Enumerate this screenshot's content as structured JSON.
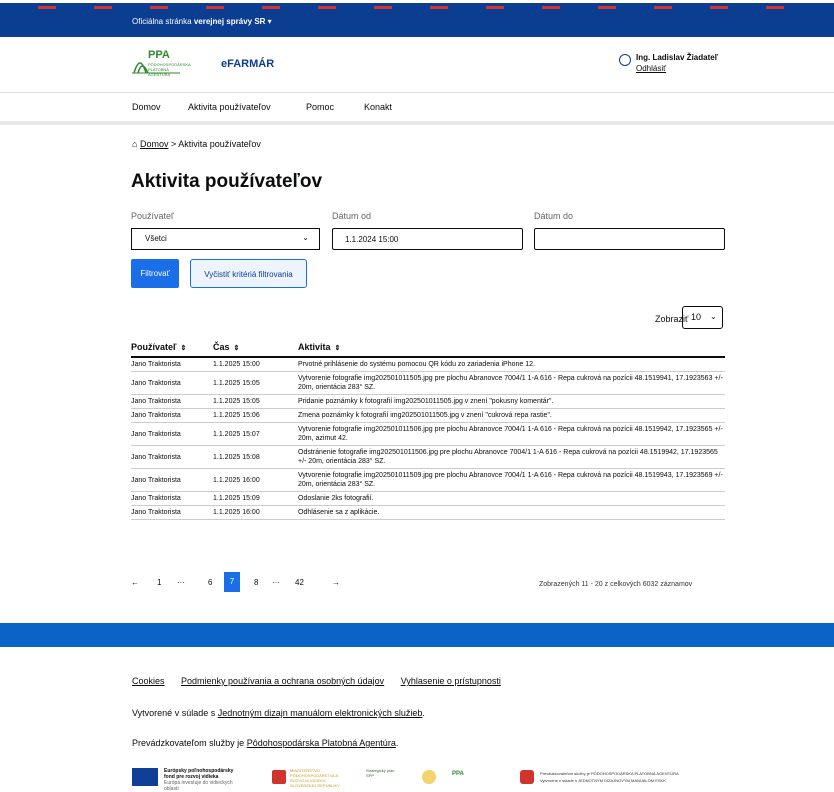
{
  "topbar": {
    "prefix": "Oficiálna stránka",
    "bold": "verejnej správy SR",
    "caret": "▾"
  },
  "header": {
    "logo_text": "PPA",
    "logo_sub": "PÔDOHOSPODÁRSKA PLATOBNÁ AGENTÚRA",
    "app_name": "eFARMÁR",
    "user_name": "Ing. Ladislav Žiadateľ",
    "logout": "Odhlásiť"
  },
  "nav": {
    "items": [
      "Domov",
      "Aktivita používateľov",
      "Pomoc",
      "Konakt"
    ]
  },
  "breadcrumb": {
    "home": "Domov",
    "separator": ">",
    "current": "Aktivita používateľov"
  },
  "page_title": "Aktivita používateľov",
  "filters": {
    "user_label": "Používateľ",
    "user_value": "Všetci",
    "from_label": "Dátum od",
    "from_value": "1.1.2024 15:00",
    "to_label": "Dátum do",
    "to_value": "",
    "filter_button": "Filtrovať",
    "clear_button": "Vyčistiť kritériá filtrovania"
  },
  "page_size": {
    "label": "Zobraziť",
    "value": "10"
  },
  "table": {
    "headers": [
      "Používateľ",
      "Čas",
      "Aktivita"
    ],
    "rows": [
      {
        "user": "Jano Traktorista",
        "time": "1.1.2025 15:00",
        "activity": "Prvotné prihlásenie do systému pomocou QR kódu zo zariadenia iPhone 12."
      },
      {
        "user": "Jano Traktorista",
        "time": "1.1.2025 15:05",
        "activity": "Vytvorenie fotografie img202501011505.jpg pre plochu Abranovce 7004/1 1-A 616 - Repa cukrová na pozícii 48.1519941, 17.1923563 +/- 20m, orientácia 283° SZ."
      },
      {
        "user": "Jano Traktorista",
        "time": "1.1.2025 15:05",
        "activity": "Pridanie poznámky k fotografií img202501011505.jpg v znení \"pokusny komentár\"."
      },
      {
        "user": "Jano Traktorista",
        "time": "1.1.2025 15:06",
        "activity": "Zmena poznámky k fotografií img202501011505.jpg v znení \"cukrová repa rastie\"."
      },
      {
        "user": "Jano Traktorista",
        "time": "1.1.2025 15:07",
        "activity": "Vytvorenie fotografie img202501011506.jpg pre plochu Abranovce 7004/1 1-A 616 - Repa cukrová na pozícii 48.1519942, 17.1923565 +/- 20m, azimut 42."
      },
      {
        "user": "Jano Traktorista",
        "time": "1.1.2025 15:08",
        "activity": "Odstránenie fotografie img202501011506.jpg pre plochu Abranovce 7004/1 1-A 616 - Repa cukrová na pozícii 48.1519942, 17.1923565 +/- 20m, orientácia 283° SZ."
      },
      {
        "user": "Jano Traktorista",
        "time": "1.1.2025 16:00",
        "activity": "Vytvorenie fotografie img202501011509.jpg pre plochu Abranovce 7004/1 1-A 616 - Repa cukrová na pozícii 48.1519943, 17.1923569 +/- 20m, orientácia 283° SZ."
      },
      {
        "user": "Jano Traktorista",
        "time": "1.1.2025 15:09",
        "activity": "Odoslanie 2ks fotografií."
      },
      {
        "user": "Jano Traktorista",
        "time": "1.1.2025 16:00",
        "activity": "Odhlásenie sa z aplikácie."
      }
    ]
  },
  "pagination": {
    "prev": "←",
    "next": "→",
    "pages": [
      "1",
      "···",
      "6",
      "7",
      "8",
      "···",
      "42"
    ],
    "active": "7",
    "summary": "Zobrazených 11 - 20 z celkových 6032 záznamov"
  },
  "footer": {
    "links": [
      "Cookies",
      "Podmienky používania a ochrana osobných údajov",
      "Vyhlasenie o prístupnosti"
    ],
    "line1_prefix": "Vytvorené v súlade s",
    "line1_link": "Jednotným dizajn manuálom elektronických služieb",
    "line2_prefix": "Prevádzkovateľom služby je",
    "line2_link": "Pôdohospodárska Platobná Agentúra",
    "logo_eu": "Európsky poľnohospodársky fond pre rozvoj vidieka",
    "logo_eu_sub": "Európa investuje do vidieckych oblastí",
    "logo_ministry": "MINISTERSTVO PÔDOHOSPODÁRSTVA A ROZVOJA VIDIEKA SLOVENSKEJ REPUBLIKY",
    "logo_mid": "Strategický plán SPP",
    "logo_ppa": "PPA",
    "logo_right_line1": "Prevádzkovateľom služby je PÔDOHOSPODÁRSKA PLATOBNÁ AGENTÚRA",
    "logo_right_line2": "Vytvorené v súlade s JEDNOTNÝM DIZAJNOVÝM MANUÁLOM ESKK"
  }
}
